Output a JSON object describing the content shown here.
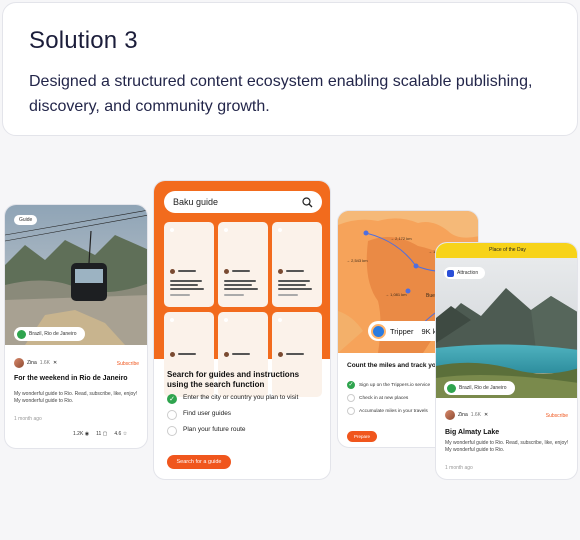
{
  "solution": {
    "title": "Solution 3",
    "description": "Designed a structured content ecosystem enabling scalable publishing, discovery, and community growth."
  },
  "card1": {
    "tag": "Guide",
    "location": "Brazil, Rio de Janeiro",
    "author": "Zina",
    "followers": "1.6K",
    "subscribe": "Subscribe",
    "title": "For the weekend in Rio de Janeiro",
    "body": "My wonderful guide to Rio. Read, subscribe, like, enjoy! My wonderful guide to Rio.",
    "time": "1 month ago",
    "views": "1.2K",
    "comments": "11",
    "stars": "4.6"
  },
  "card2": {
    "search_value": "Baku guide",
    "heading": "Search for guides and instructions using the search function",
    "items": [
      {
        "label": "Enter the city or country you plan to visit",
        "checked": true
      },
      {
        "label": "Find user guides",
        "checked": false
      },
      {
        "label": "Plan your future route",
        "checked": false
      }
    ],
    "button": "Search for a guide"
  },
  "card3": {
    "distances": [
      "→ 2,172 km",
      "→ 1,412 km",
      "→ 2,543 km",
      "→ 1,081 km",
      "Bue"
    ],
    "tripper_label": "Tripper",
    "tripper_km": "9K km",
    "heading": "Count the miles and track your progress",
    "items": [
      {
        "label": "Sign up on the Trippers.io service",
        "checked": true
      },
      {
        "label": "Check in at new places",
        "checked": false
      },
      {
        "label": "Accumulate miles in your travels",
        "checked": false
      }
    ],
    "button": "Prepare"
  },
  "card4": {
    "banner": "Place of the Day",
    "tag": "Attraction",
    "location": "Brazil, Rio de Janeiro",
    "author": "Zina",
    "followers": "1.6K",
    "subscribe": "Subscribe",
    "title": "Big Almaty Lake",
    "body": "My wonderful guide to Rio. Read, subscribe, like, enjoy! My wonderful guide to Rio.",
    "time": "1 month ago"
  },
  "colors": {
    "accent_orange": "#f0561d",
    "check_green": "#2fa44e",
    "banner_yellow": "#f7d31a"
  }
}
